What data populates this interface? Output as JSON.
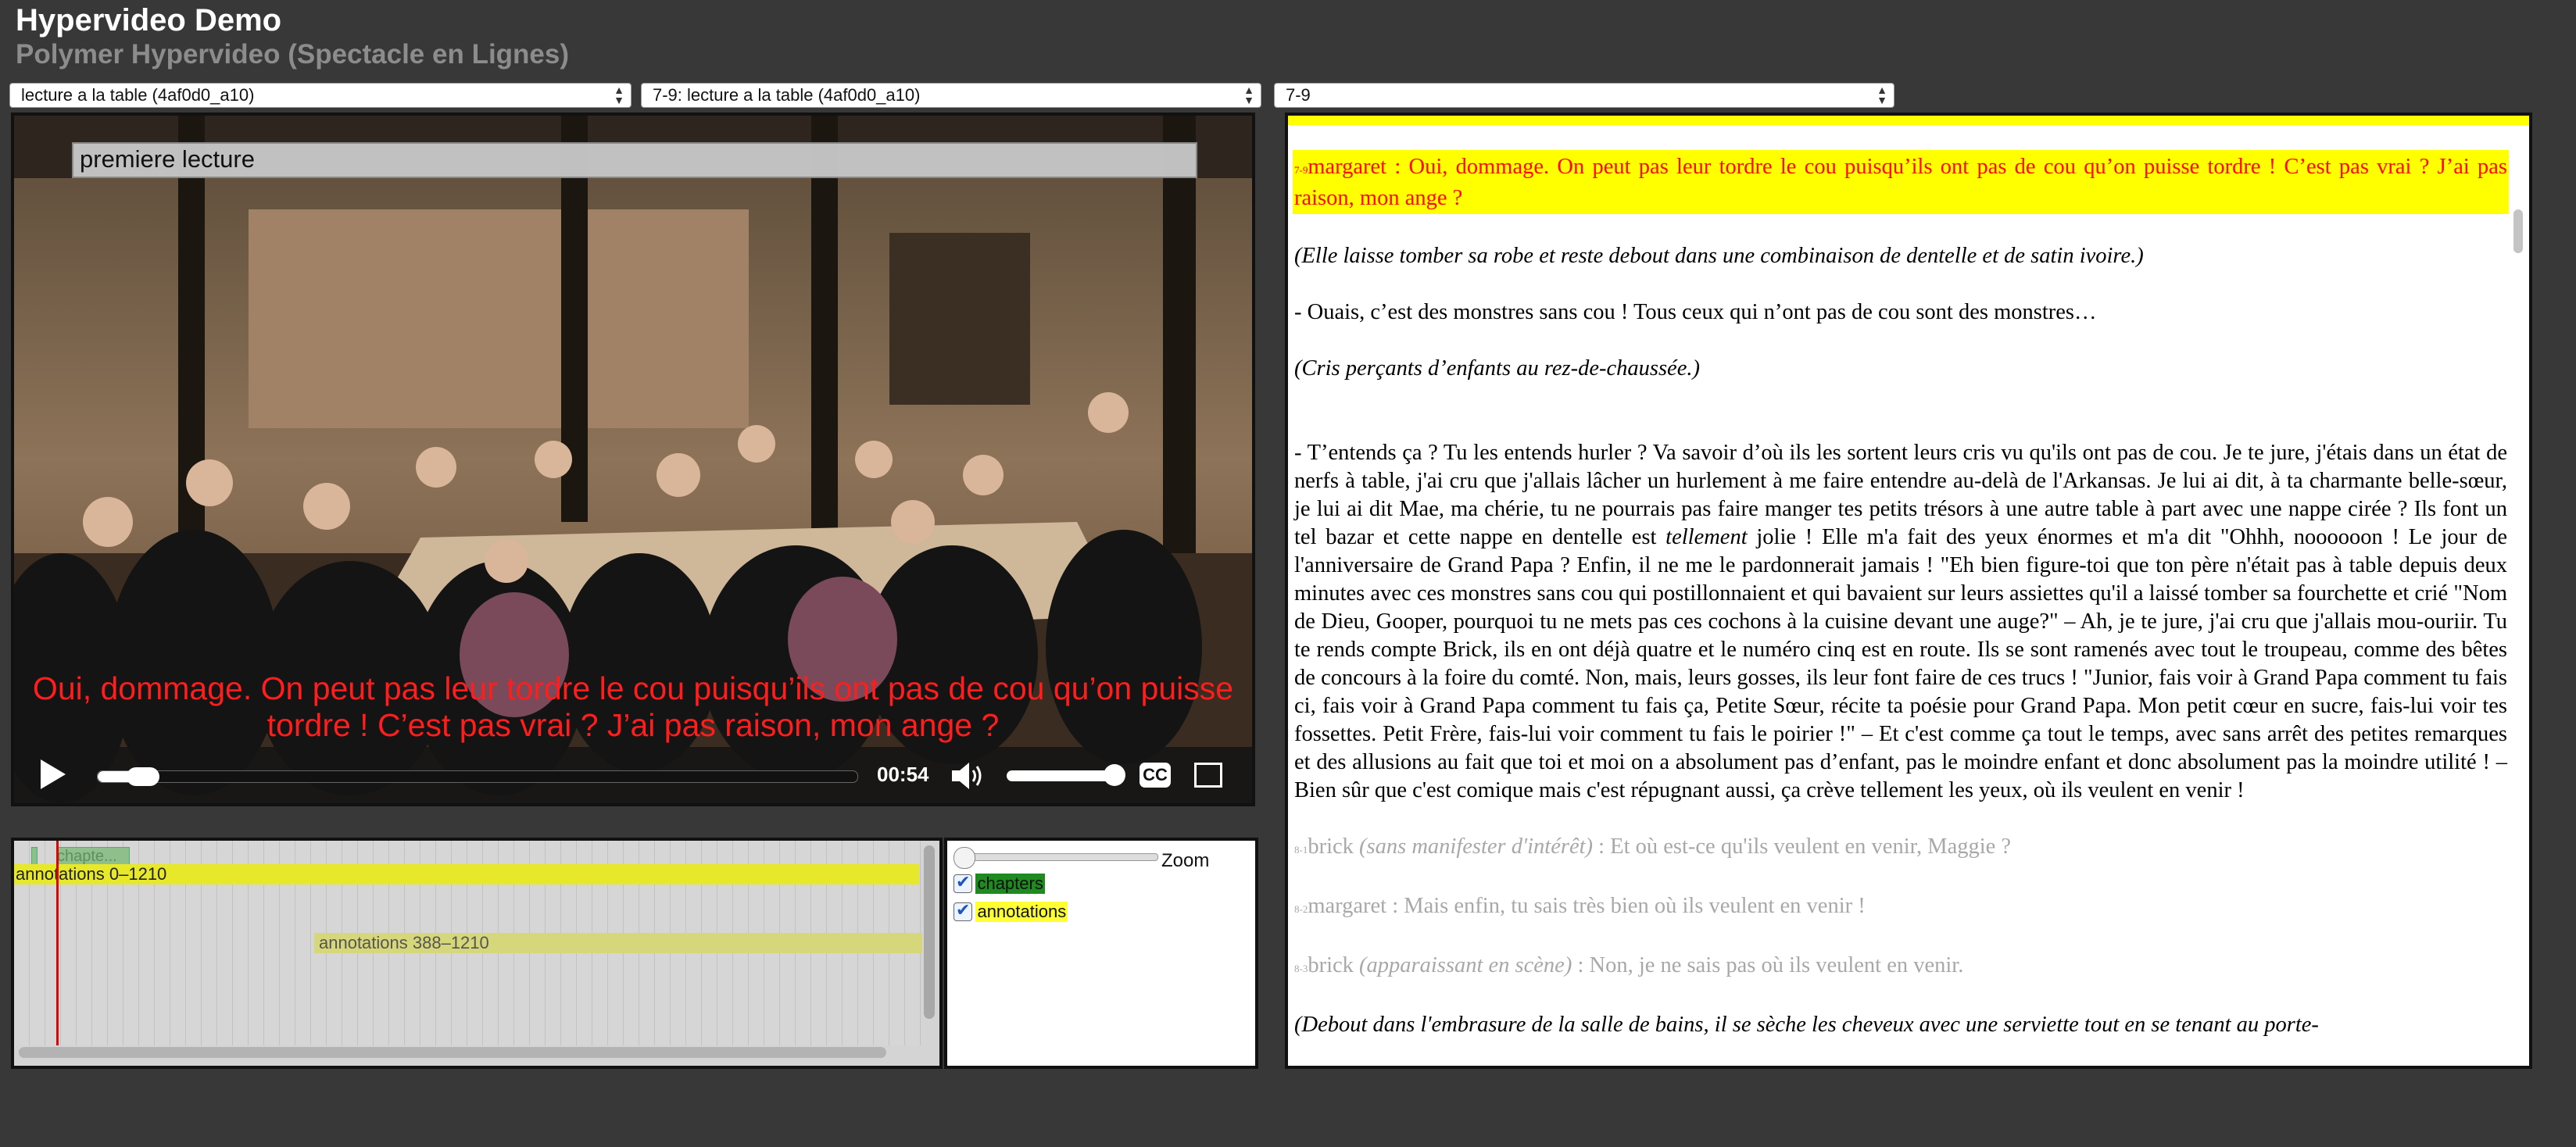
{
  "app": {
    "title": "Hypervideo Demo",
    "subtitle": "Polymer Hypervideo (Spectacle en Lignes)"
  },
  "selectors": {
    "video_select": "lecture a la table (4af0d0_a10)",
    "annotation_select": "7-9: lecture a la table (4af0d0_a10)",
    "segment_select": "7-9"
  },
  "player": {
    "chapter_overlay": "premiere lecture",
    "caption": "Oui, dommage. On peut pas leur tordre le cou puisqu’ils ont pas de cou qu’on puisse tordre ! C’est pas vrai ? J’ai pas raison, mon ange ?",
    "time": "00:54",
    "progress": 0.06,
    "volume": 0.88,
    "cc_label": "CC",
    "icons": [
      "play-icon",
      "volume-icon",
      "closed-captions-icon",
      "fullscreen-icon"
    ]
  },
  "timeline": {
    "chapter_track_label": "chapte...",
    "annotations_all": "annotations 0–1210",
    "annotations_range": "annotations 388–1210"
  },
  "legend": {
    "zoom_label": "Zoom",
    "items": [
      {
        "label": "chapters",
        "checked": true,
        "color": "#1f8a1f"
      },
      {
        "label": "annotations",
        "checked": true,
        "color": "#ffff33"
      }
    ]
  },
  "transcript": {
    "current_num": "7-9",
    "current_text": "margaret : Oui, dommage. On peut pas leur tordre le cou puisqu’ils ont pas de cou qu’on puisse tordre ! C’est pas vrai ? J’ai pas raison, mon ange ?",
    "dir1": "(Elle laisse tomber sa robe et reste debout dans une combinaison de dentelle et de satin ivoire.)",
    "line1": "- Ouais, c’est des monstres sans cou ! Tous ceux qui n’ont pas de cou sont des monstres…",
    "dir2": "(Cris perçants d’enfants au rez-de-chaussée.)",
    "long_a": "- T’entends ça ? Tu les entends hurler ? Va savoir d’où ils les sortent leurs cris vu qu'ils ont pas de cou. Je te jure, j'étais dans un état de nerfs à table, j'ai cru que j'allais lâcher un hurlement à me faire entendre au-delà de l'Arkansas. Je lui ai dit, à ta charmante belle-sœur, je lui ai dit Mae, ma chérie, tu ne pourrais pas faire manger tes petits trésors à une autre table à part avec une nappe cirée ? Ils font un tel bazar et cette nappe en dentelle est ",
    "long_em": "tellement",
    "long_b": " jolie ! Elle m'a fait des yeux énormes et m'a dit \"Ohhh, noooooon ! Le jour de l'anniversaire de Grand Papa ? Enfin, il ne me le pardonnerait jamais ! \"Eh bien figure-toi que ton père n'était pas à table depuis deux minutes avec ces monstres sans cou qui postillonnaient et qui bavaient sur leurs assiettes qu'il a laissé tomber sa fourchette et crié \"Nom de Dieu, Gooper, pourquoi tu ne mets pas ces cochons à la cuisine devant une auge?\" – Ah, je te jure, j'ai cru que j'allais mou-ouriir. Tu te rends compte Brick, ils en ont déjà quatre et le numéro cinq est en route. Ils se sont ramenés avec tout le troupeau, comme des bêtes de concours à la foire du comté. Non, mais, leurs gosses, ils leur font faire de ces trucs ! \"Junior, fais voir à Grand Papa comment tu fais ci, fais voir à Grand Papa comment tu fais ça, Petite Sœur, récite ta poésie pour Grand Papa. Mon petit cœur en sucre, fais-lui voir tes fossettes. Petit Frère, fais-lui voir comment tu fais le poirier !\" – Et c'est comme ça tout le temps, avec sans arrêt des petites remarques et des allusions au fait que toi et moi on a absolument pas d’enfant, pas le moindre enfant et donc absolument pas la moindre utilité ! – Bien sûr que c'est comique mais c'est répugnant aussi, ça crève tellement les yeux, où ils veulent en venir !",
    "l81_num": "8-1",
    "l81_speaker": "brick ",
    "l81_dir": "(sans manifester d'intérêt)",
    "l81_text": " : Et où est-ce qu'ils veulent en venir, Maggie ?",
    "l82_num": "8-2",
    "l82_text": "margaret : Mais enfin, tu sais très bien où ils veulent en venir !",
    "l83_num": "8-3",
    "l83_speaker": "brick ",
    "l83_dir": "(apparaissant en scène)",
    "l83_text": " : Non, je ne sais pas où ils veulent en venir.",
    "dir3": "(Debout dans l'embrasure de la salle de bains, il se sèche les cheveux avec une serviette tout en se tenant au porte-"
  }
}
